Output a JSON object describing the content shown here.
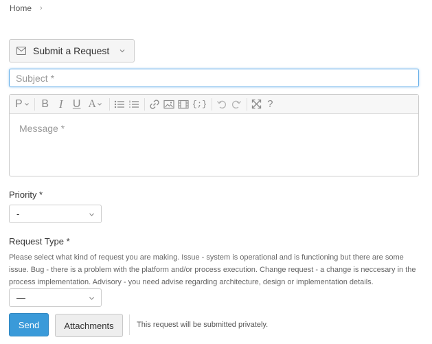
{
  "breadcrumb": {
    "home": "Home",
    "separator": "›"
  },
  "form_type": {
    "label": "Submit a Request",
    "icon": "envelope-icon"
  },
  "subject": {
    "placeholder": "Subject *",
    "value": ""
  },
  "editor": {
    "placeholder": "Message *",
    "toolbar": [
      "paragraph",
      "bold",
      "italic",
      "underline",
      "font-size",
      "bullet-list",
      "numbered-list",
      "link",
      "image",
      "video",
      "code",
      "undo",
      "redo",
      "fullscreen",
      "help"
    ],
    "paragraph_glyph": "P",
    "bold_glyph": "B",
    "italic_glyph": "I",
    "underline_glyph": "U",
    "font_size_glyph": "A",
    "code_glyph": "{;}",
    "help_glyph": "?"
  },
  "priority": {
    "label": "Priority *",
    "value": "-"
  },
  "request_type": {
    "label": "Request Type *",
    "help": "Please select what kind of request you are making. Issue - system is operational and is functioning but there are some issue. Bug - there is a problem with the platform and/or process execution. Change request - a change is neccesary in the process implementation. Advisory - you need advise regarding architecture, design or implementation details.",
    "value": "—"
  },
  "actions": {
    "send": "Send",
    "attachments": "Attachments",
    "note": "This request will be submitted privately."
  },
  "colors": {
    "primary": "#3a9ad9",
    "focus": "#66afe9",
    "border": "#cccccc"
  }
}
